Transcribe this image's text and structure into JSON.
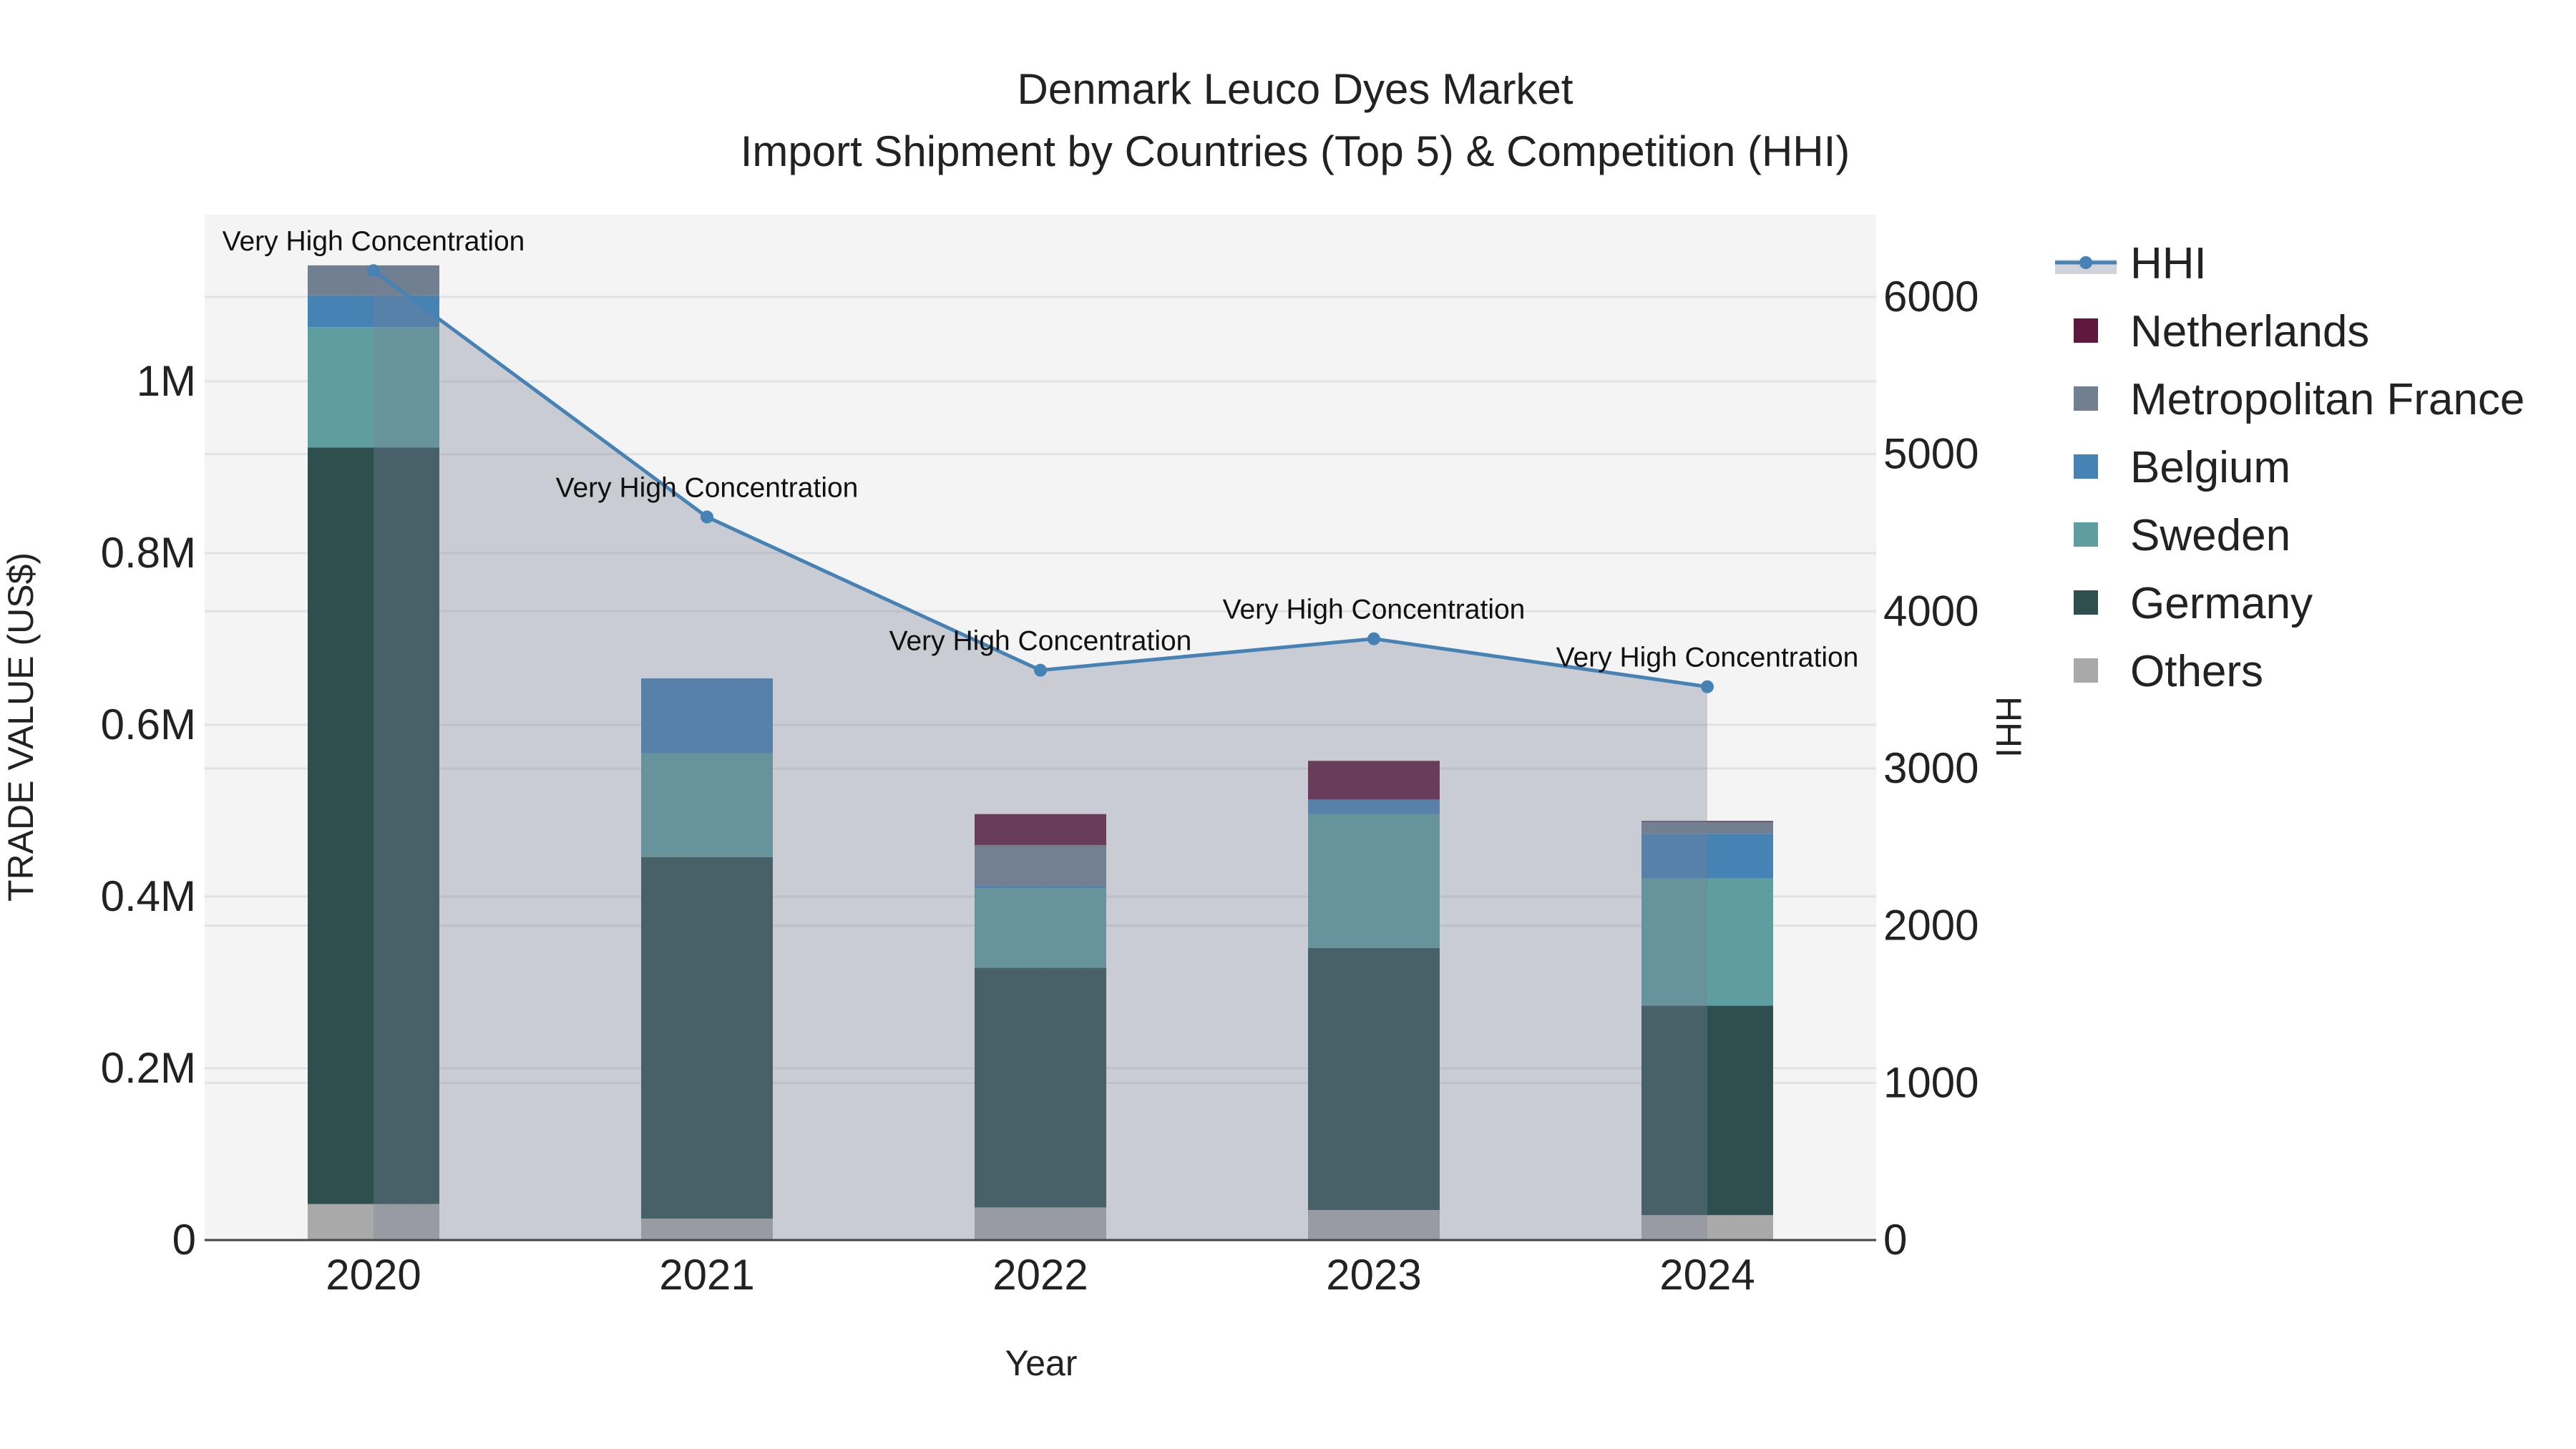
{
  "chart_data": {
    "type": "bar",
    "title": "Denmark Leuco Dyes Market",
    "subtitle": "Import Shipment by Countries (Top 5) & Competition (HHI)",
    "xlabel": "Year",
    "ylabel": "TRADE VALUE (US$)",
    "y2label": "HHI",
    "categories": [
      "2020",
      "2021",
      "2022",
      "2023",
      "2024"
    ],
    "stacked": true,
    "ylim": [
      0,
      1194000
    ],
    "y2lim": [
      0,
      6523
    ],
    "yticks": [
      {
        "v": 0,
        "label": "0"
      },
      {
        "v": 200000,
        "label": "0.2M"
      },
      {
        "v": 400000,
        "label": "0.4M"
      },
      {
        "v": 600000,
        "label": "0.6M"
      },
      {
        "v": 800000,
        "label": "0.8M"
      },
      {
        "v": 1000000,
        "label": "1M"
      }
    ],
    "y2ticks": [
      {
        "v": 0,
        "label": "0"
      },
      {
        "v": 1000,
        "label": "1000"
      },
      {
        "v": 2000,
        "label": "2000"
      },
      {
        "v": 3000,
        "label": "3000"
      },
      {
        "v": 4000,
        "label": "4000"
      },
      {
        "v": 5000,
        "label": "5000"
      },
      {
        "v": 6000,
        "label": "6000"
      }
    ],
    "grid": true,
    "legend_position": "right",
    "series": [
      {
        "name": "Others",
        "color": "#a9a9a9",
        "values": [
          42000,
          25000,
          38000,
          35000,
          29000
        ]
      },
      {
        "name": "Germany",
        "color": "#2f4f4f",
        "values": [
          881000,
          421000,
          279000,
          305000,
          244000
        ]
      },
      {
        "name": "Sweden",
        "color": "#5f9ea0",
        "values": [
          140000,
          121000,
          93000,
          156000,
          148000
        ]
      },
      {
        "name": "Belgium",
        "color": "#4682b4",
        "values": [
          37000,
          87000,
          3000,
          17000,
          52000
        ]
      },
      {
        "name": "Metropolitan France",
        "color": "#708090",
        "values": [
          35000,
          0,
          47000,
          0,
          14000
        ]
      },
      {
        "name": "Netherlands",
        "color": "#5e1a3c",
        "values": [
          0,
          0,
          36000,
          45000,
          1000
        ]
      }
    ],
    "line": {
      "name": "HHI",
      "color": "#4682b4",
      "axis": "right",
      "values": [
        6167,
        4600,
        3625,
        3825,
        3520
      ],
      "annotations": [
        "Very High Concentration",
        "Very High Concentration",
        "Very High Concentration",
        "Very High Concentration",
        "Very High Concentration"
      ]
    },
    "legend": [
      "HHI",
      "Netherlands",
      "Metropolitan France",
      "Belgium",
      "Sweden",
      "Germany",
      "Others"
    ]
  }
}
